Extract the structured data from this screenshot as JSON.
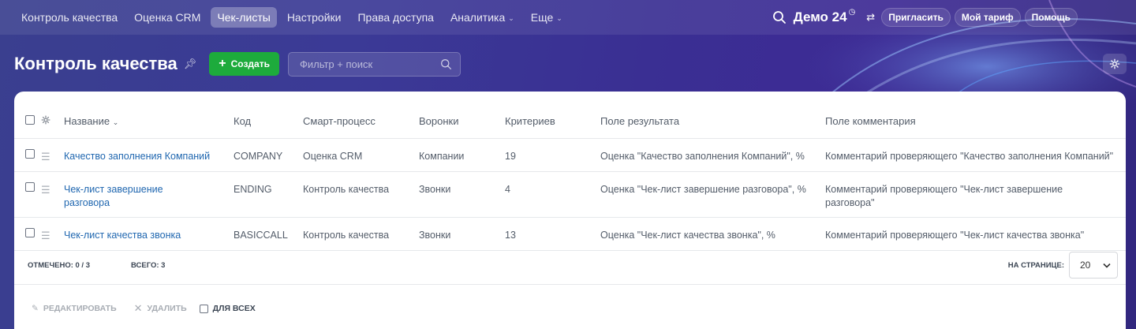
{
  "topnav": {
    "items": [
      {
        "label": "Контроль качества"
      },
      {
        "label": "Оценка CRM"
      },
      {
        "label": "Чек-листы",
        "active": true
      },
      {
        "label": "Настройки"
      },
      {
        "label": "Права доступа"
      },
      {
        "label": "Аналитика",
        "dropdown": true
      },
      {
        "label": "Еще",
        "dropdown": true
      }
    ],
    "brand": "Демо 24",
    "invite_label": "Пригласить",
    "tariff_label": "Мой тариф",
    "help_label": "Помощь"
  },
  "header": {
    "title": "Контроль качества",
    "create_label": "Создать",
    "filter_placeholder": "Фильтр + поиск"
  },
  "table": {
    "columns": [
      "Название",
      "Код",
      "Смарт-процесс",
      "Воронки",
      "Критериев",
      "Поле результата",
      "Поле комментария"
    ],
    "rows": [
      {
        "name": "Качество заполнения Компаний",
        "code": "COMPANY",
        "process": "Оценка CRM",
        "funnel": "Компании",
        "criteria": "19",
        "result_field": "Оценка \"Качество заполнения Компаний\", %",
        "comment_field": "Комментарий проверяющего \"Качество заполнения Компаний\""
      },
      {
        "name": "Чек-лист завершение разговора",
        "code": "ENDING",
        "process": "Контроль качества",
        "funnel": "Звонки",
        "criteria": "4",
        "result_field": "Оценка \"Чек-лист завершение разговора\", %",
        "comment_field": "Комментарий проверяющего \"Чек-лист завершение разговора\""
      },
      {
        "name": "Чек-лист качества звонка",
        "code": "BASICCALL",
        "process": "Контроль качества",
        "funnel": "Звонки",
        "criteria": "13",
        "result_field": "Оценка \"Чек-лист качества звонка\", %",
        "comment_field": "Комментарий проверяющего \"Чек-лист качества звонка\""
      }
    ]
  },
  "footer": {
    "selected_label": "ОТМЕЧЕНО: 0 / 3",
    "total_label": "ВСЕГО: 3",
    "per_page_label": "НА СТРАНИЦЕ:",
    "per_page_value": "20",
    "edit_label": "РЕДАКТИРОВАТЬ",
    "delete_label": "УДАЛИТЬ",
    "for_all_label": "ДЛЯ ВСЕХ"
  },
  "colors": {
    "accent_green": "#1dab3c",
    "link_blue": "#2067b0"
  },
  "icons": [
    "search-icon",
    "clock-icon",
    "swap-icon",
    "pin-icon",
    "plus-icon",
    "gear-icon",
    "chevron-down-icon",
    "drag-handle-icon",
    "pencil-icon",
    "close-icon"
  ]
}
